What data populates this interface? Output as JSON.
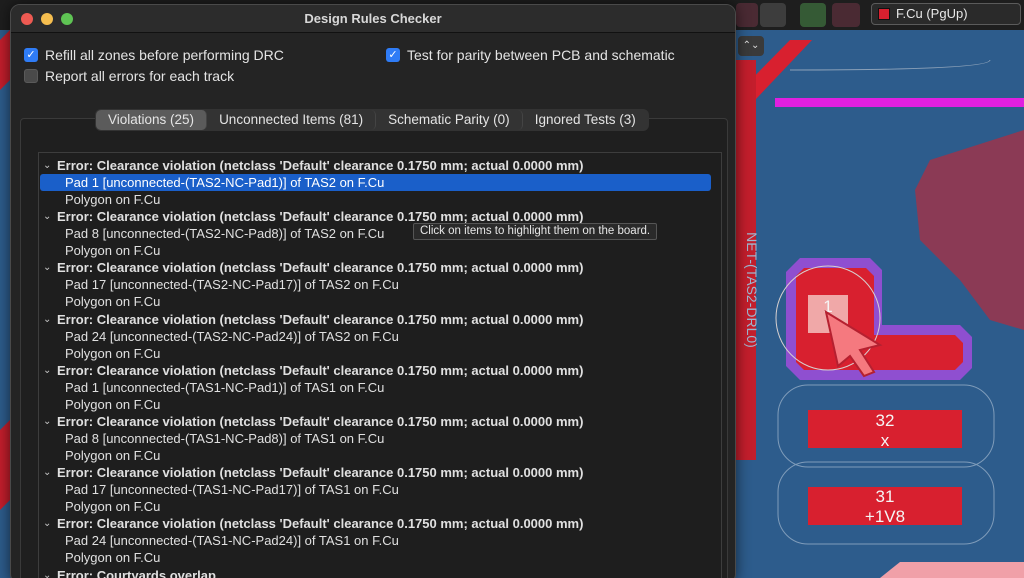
{
  "dialog": {
    "title": "Design Rules Checker",
    "options": {
      "refill_zones": {
        "label": "Refill all zones before performing DRC",
        "checked": true
      },
      "report_all_errors": {
        "label": "Report all errors for each track",
        "checked": false
      },
      "test_parity": {
        "label": "Test for parity between PCB and schematic",
        "checked": true
      }
    },
    "tabs": [
      {
        "label": "Violations (25)",
        "active": true
      },
      {
        "label": "Unconnected Items (81)",
        "active": false
      },
      {
        "label": "Schematic Parity (0)",
        "active": false
      },
      {
        "label": "Ignored Tests (3)",
        "active": false
      }
    ],
    "violations": [
      {
        "title": "Error: Clearance violation (netclass 'Default' clearance 0.1750 mm; actual 0.0000 mm)",
        "items": [
          "Pad 1 [unconnected-(TAS2-NC-Pad1)] of TAS2 on F.Cu",
          "Polygon on F.Cu"
        ]
      },
      {
        "title": "Error: Clearance violation (netclass 'Default' clearance 0.1750 mm; actual 0.0000 mm)",
        "items": [
          "Pad 8 [unconnected-(TAS2-NC-Pad8)] of TAS2 on F.Cu",
          "Polygon on F.Cu"
        ]
      },
      {
        "title": "Error: Clearance violation (netclass 'Default' clearance 0.1750 mm; actual 0.0000 mm)",
        "items": [
          "Pad 17 [unconnected-(TAS2-NC-Pad17)] of TAS2 on F.Cu",
          "Polygon on F.Cu"
        ]
      },
      {
        "title": "Error: Clearance violation (netclass 'Default' clearance 0.1750 mm; actual 0.0000 mm)",
        "items": [
          "Pad 24 [unconnected-(TAS2-NC-Pad24)] of TAS2 on F.Cu",
          "Polygon on F.Cu"
        ]
      },
      {
        "title": "Error: Clearance violation (netclass 'Default' clearance 0.1750 mm; actual 0.0000 mm)",
        "items": [
          "Pad 1 [unconnected-(TAS1-NC-Pad1)] of TAS1 on F.Cu",
          "Polygon on F.Cu"
        ]
      },
      {
        "title": "Error: Clearance violation (netclass 'Default' clearance 0.1750 mm; actual 0.0000 mm)",
        "items": [
          "Pad 8 [unconnected-(TAS1-NC-Pad8)] of TAS1 on F.Cu",
          "Polygon on F.Cu"
        ]
      },
      {
        "title": "Error: Clearance violation (netclass 'Default' clearance 0.1750 mm; actual 0.0000 mm)",
        "items": [
          "Pad 17 [unconnected-(TAS1-NC-Pad17)] of TAS1 on F.Cu",
          "Polygon on F.Cu"
        ]
      },
      {
        "title": "Error: Clearance violation (netclass 'Default' clearance 0.1750 mm; actual 0.0000 mm)",
        "items": [
          "Pad 24 [unconnected-(TAS1-NC-Pad24)] of TAS1 on F.Cu",
          "Polygon on F.Cu"
        ]
      },
      {
        "title": "Error: Courtyards overlap",
        "items": []
      }
    ],
    "tooltip": "Click on items to highlight them on the board."
  },
  "toolbar": {
    "layer_label": "F.Cu (PgUp)",
    "layer_color": "#d8202f"
  },
  "board": {
    "pad_1": "1",
    "pad_32_number": "32",
    "pad_32_net": "x",
    "pad_31_number": "31",
    "pad_31_net": "+1V8",
    "net_label": "NET-(TAS2-DRL0)",
    "copper_color": "#d8202f",
    "background_color": "#2b5a8a"
  }
}
